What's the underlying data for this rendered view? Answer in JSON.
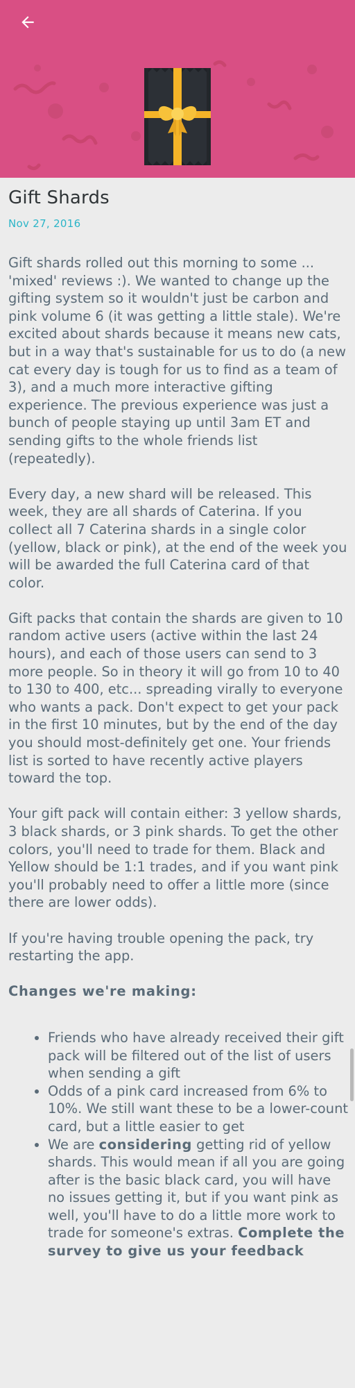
{
  "header": {
    "back_icon": "arrow-left-icon",
    "hero_color": "#d94f84",
    "gift_icon": "gift-pack-icon"
  },
  "post": {
    "title": "Gift Shards",
    "date": "Nov 27, 2016",
    "paragraphs": [
      "Gift shards rolled out this morning to some ... 'mixed' reviews :). We wanted to change up the gifting system so it wouldn't just be carbon and pink volume 6 (it was getting a little stale). We're excited about shards because it means new cats, but in a way that's sustainable for us to do (a new cat every day is tough for us to find as a team of 3), and a much more interactive gifting experience. The previous experience was just a bunch of people staying up until 3am ET and sending gifts to the whole friends list (repeatedly).",
      "Every day, a new shard will be released. This week, they are all shards of Caterina. If you collect all 7 Caterina shards in a single color (yellow, black or pink), at the end of the week you will be awarded the full Caterina card of that color.",
      "Gift packs that contain the shards are given to 10 random active users (active within the last 24 hours), and each of those users can send to 3 more people. So in theory it will go from 10 to 40 to 130 to 400, etc... spreading virally to everyone who wants a pack. Don't expect to get your pack in the first 10 minutes, but by the end of the day you should most-definitely get one. Your friends list is sorted to have recently active players toward the top.",
      "Your gift pack will contain either: 3 yellow shards, 3 black shards, or 3 pink shards. To get the other colors, you'll need to trade for them. Black and Yellow should be 1:1 trades, and if you want pink you'll probably need to offer a little more (since there are lower odds).",
      "If you're having trouble opening the pack, try restarting the app."
    ],
    "changes_heading": "Changes we're making:",
    "changes": [
      "Friends who have already received their gift pack will be filtered out of the list of users when sending a gift",
      "Odds of a pink card increased from 6% to 10%. We still want these to be a lower-count card, but a little easier to get"
    ],
    "change3": {
      "pre": "We are ",
      "bold": "considering",
      "mid": " getting rid of yellow shards. This would mean if all you are going after is the basic black card, you will have no issues getting it, but if you want pink as well, you'll have to do a little more work to trade for someone's extras. ",
      "bold_end": "Complete the survey to give us your feedback"
    }
  },
  "colors": {
    "title": "#2f3437",
    "date": "#2bb5c8",
    "body": "#5a6b78",
    "background": "#ececec"
  }
}
